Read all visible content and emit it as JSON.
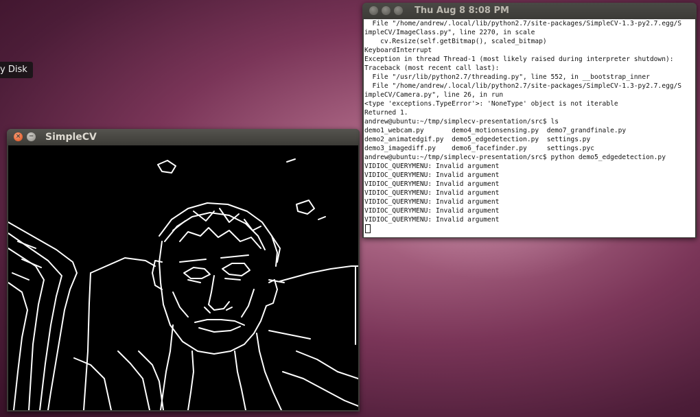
{
  "desktop": {
    "icon_label": "y Disk"
  },
  "cv_window": {
    "title": "SimpleCV",
    "close_glyph": "×",
    "min_glyph": "−"
  },
  "terminal": {
    "clock": "Thu Aug  8  8:08 PM",
    "lines": [
      "  File \"/home/andrew/.local/lib/python2.7/site-packages/SimpleCV-1.3-py2.7.egg/S",
      "impleCV/ImageClass.py\", line 2270, in scale",
      "    cv.Resize(self.getBitmap(), scaled_bitmap)",
      "KeyboardInterrupt",
      "Exception in thread Thread-1 (most likely raised during interpreter shutdown):",
      "Traceback (most recent call last):",
      "  File \"/usr/lib/python2.7/threading.py\", line 552, in __bootstrap_inner",
      "  File \"/home/andrew/.local/lib/python2.7/site-packages/SimpleCV-1.3-py2.7.egg/S",
      "impleCV/Camera.py\", line 26, in run",
      "<type 'exceptions.TypeError'>: 'NoneType' object is not iterable",
      "Returned 1.",
      "andrew@ubuntu:~/tmp/simplecv-presentation/src$ ls",
      "demo1_webcam.py       demo4_motionsensing.py  demo7_grandfinale.py",
      "demo2_animatedgif.py  demo5_edgedetection.py  settings.py",
      "demo3_imagediff.py    demo6_facefinder.py     settings.pyc",
      "andrew@ubuntu:~/tmp/simplecv-presentation/src$ python demo5_edgedetection.py",
      "VIDIOC_QUERYMENU: Invalid argument",
      "VIDIOC_QUERYMENU: Invalid argument",
      "VIDIOC_QUERYMENU: Invalid argument",
      "VIDIOC_QUERYMENU: Invalid argument",
      "VIDIOC_QUERYMENU: Invalid argument",
      "VIDIOC_QUERYMENU: Invalid argument",
      "VIDIOC_QUERYMENU: Invalid argument"
    ]
  },
  "colors": {
    "accent_close": "#df4b16",
    "titlebar": "#3c3b37",
    "terminal_bg": "#ffffff",
    "canvas_bg": "#000000",
    "edge_stroke": "#ffffff"
  },
  "icons": [
    "close-icon",
    "minimize-icon",
    "maximize-icon"
  ]
}
